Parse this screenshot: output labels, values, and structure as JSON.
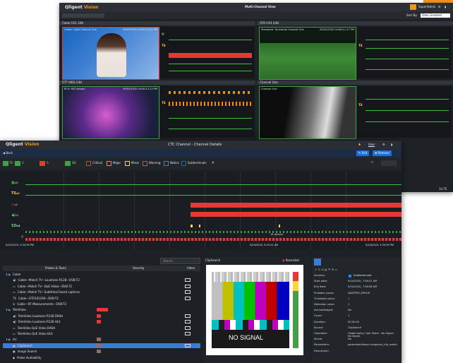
{
  "colors": {
    "orange": "#f29422",
    "critical": "#e53935",
    "major": "#fb8c00",
    "minor": "#fdd835",
    "warning": "#8d6e63",
    "notice": "#1e88e5",
    "ok": "#43a047",
    "selected": "#3a7bd5"
  },
  "back_window": {
    "app_name": "Qligent",
    "app_sub": "Vision",
    "title": "Multi-Channel View",
    "user": "SuperAdmin",
    "sort_label": "Sort By:",
    "sort_value": "Date Greatest",
    "panes": [
      {
        "name": "Cable CH1 24H",
        "overlay": "Cable: Cable Channel One",
        "timestamp": "09/03/2020 04:08:14:21 PM",
        "border": "#e53935"
      },
      {
        "name": "OTA CH1 24H",
        "overlay": "Terrestrial: Terrestrial Channel One",
        "timestamp": "09/03/2020 04:08:11:17 PM",
        "border": "#43a047"
      },
      {
        "name": "OTT KIDS 24H",
        "overlay": "RCH: RCS Kenobi",
        "timestamp": "09/03/2020 04:08:12:13 PM",
        "border": "#43a047"
      },
      {
        "name": "Channel One",
        "overlay": "Channel One",
        "timestamp": "",
        "border": "#43a047"
      }
    ],
    "meter_labels": [
      "TS",
      "TS",
      "TS",
      "TS"
    ],
    "corner_value": "14.75"
  },
  "front_window": {
    "app_name": "Qligent",
    "app_sub": "Vision",
    "title": "CTC Channel - Channel Details",
    "user": "User",
    "back_label": "Back",
    "edit_label": "Edit",
    "remove_label": "Remove",
    "filters": [
      {
        "label": "Critical",
        "color": "#e53935"
      },
      {
        "label": "Major",
        "color": "#fb8c00"
      },
      {
        "label": "Minor",
        "color": "#fdd835"
      },
      {
        "label": "Warning",
        "color": "#8d6e63"
      },
      {
        "label": "Notice",
        "color": "#1e88e5"
      },
      {
        "label": "Subterminals",
        "color": "#1565c0"
      }
    ],
    "status_chips": [
      "TS",
      "V",
      "A",
      "SD"
    ],
    "timeline": {
      "start": "9/23/2020, 3:34:39 PM",
      "end": "9/24/2020, 3:34:39 PM",
      "cursor_label": "9/24/2020, 7:49:29 AM",
      "mid_label": "9/24/2020, 9:15:21 AM",
      "zoom_label": "15 minute",
      "tracks": [
        "x0",
        "x0",
        "x2",
        "x2",
        "x5"
      ]
    },
    "search_placeholder": "Search",
    "tree": {
      "headers": [
        "Probes & Tasks",
        "Severity",
        "Video"
      ],
      "rows": [
        {
          "label": "Cable",
          "indent": 0,
          "type": "group",
          "severity": "",
          "video": false
        },
        {
          "label": "Cable—Match TV—Loudness R128—DVB-T2",
          "indent": 1,
          "type": "audio",
          "severity": "",
          "video": true
        },
        {
          "label": "Cable—Match TV—QoE Video—DVB-T2",
          "indent": 1,
          "type": "video",
          "severity": "",
          "video": true
        },
        {
          "label": "Cable—Match TV—Subtitles/Closed captions",
          "indent": 1,
          "type": "cc",
          "severity": "",
          "video": true
        },
        {
          "label": "Cable—ETR101290—DVB-T2",
          "indent": 1,
          "type": "ts",
          "severity": "",
          "video": true
        },
        {
          "label": "Cable—RF Measurements—DVB-T2",
          "indent": 1,
          "type": "rf",
          "severity": "",
          "video": false
        },
        {
          "label": "TeleVideo",
          "indent": 0,
          "type": "group",
          "severity": "bar",
          "video": false
        },
        {
          "label": "TeleVideo Loudness R128 DASH",
          "indent": 1,
          "type": "audio",
          "severity": "crit",
          "video": true
        },
        {
          "label": "TeleVideo Loudness R128 HLS",
          "indent": 1,
          "type": "audio",
          "severity": "crit",
          "video": true
        },
        {
          "label": "TeleVideo QoE Video DASH",
          "indent": 1,
          "type": "video",
          "severity": "",
          "video": true
        },
        {
          "label": "TeleVideo QoE Video HLS",
          "indent": 1,
          "type": "video",
          "severity": "",
          "video": true
        },
        {
          "label": "ctc",
          "indent": 0,
          "type": "group",
          "severity": "warn",
          "video": false
        },
        {
          "label": "ClipSearch",
          "indent": 1,
          "type": "clip",
          "severity": "warn",
          "video": true,
          "selected": true
        },
        {
          "label": "Image Search",
          "indent": 1,
          "type": "image",
          "severity": "warn",
          "video": false
        },
        {
          "label": "Probe Availability",
          "indent": 1,
          "type": "probe",
          "severity": "",
          "video": false
        }
      ]
    },
    "clip": {
      "title": "ClipSearch",
      "recorded": "Recorded",
      "no_signal": "NO SIGNAL"
    },
    "details": {
      "status": "Indeterminate",
      "rows": [
        {
          "k": "Severity:",
          "v": ""
        },
        {
          "k": "Start date:",
          "v": "9/24/2020, 7:56:01 AM"
        },
        {
          "k": "End date:",
          "v": "9/24/2020, 7:58:06 AM"
        },
        {
          "k": "Probable cause:",
          "v": "ADAPTER_ERROR"
        },
        {
          "k": "Threshold value:",
          "v": "1"
        },
        {
          "k": "Detection value:",
          "v": "1"
        },
        {
          "k": "Acknowledged:",
          "v": "No"
        },
        {
          "k": "Count:",
          "v": "1"
        },
        {
          "k": "Duration:",
          "v": "00:00:05"
        },
        {
          "k": "Source:",
          "v": "ClipSearch"
        },
        {
          "k": "Originator:",
          "v": "Global policy: QoE Video - No Signal - No Signal"
        },
        {
          "k": "Active:",
          "v": "No"
        },
        {
          "k": "Parameters:",
          "v": "parameterName=snapshot_clip_match"
        },
        {
          "k": "Description:",
          "v": ""
        }
      ]
    }
  }
}
